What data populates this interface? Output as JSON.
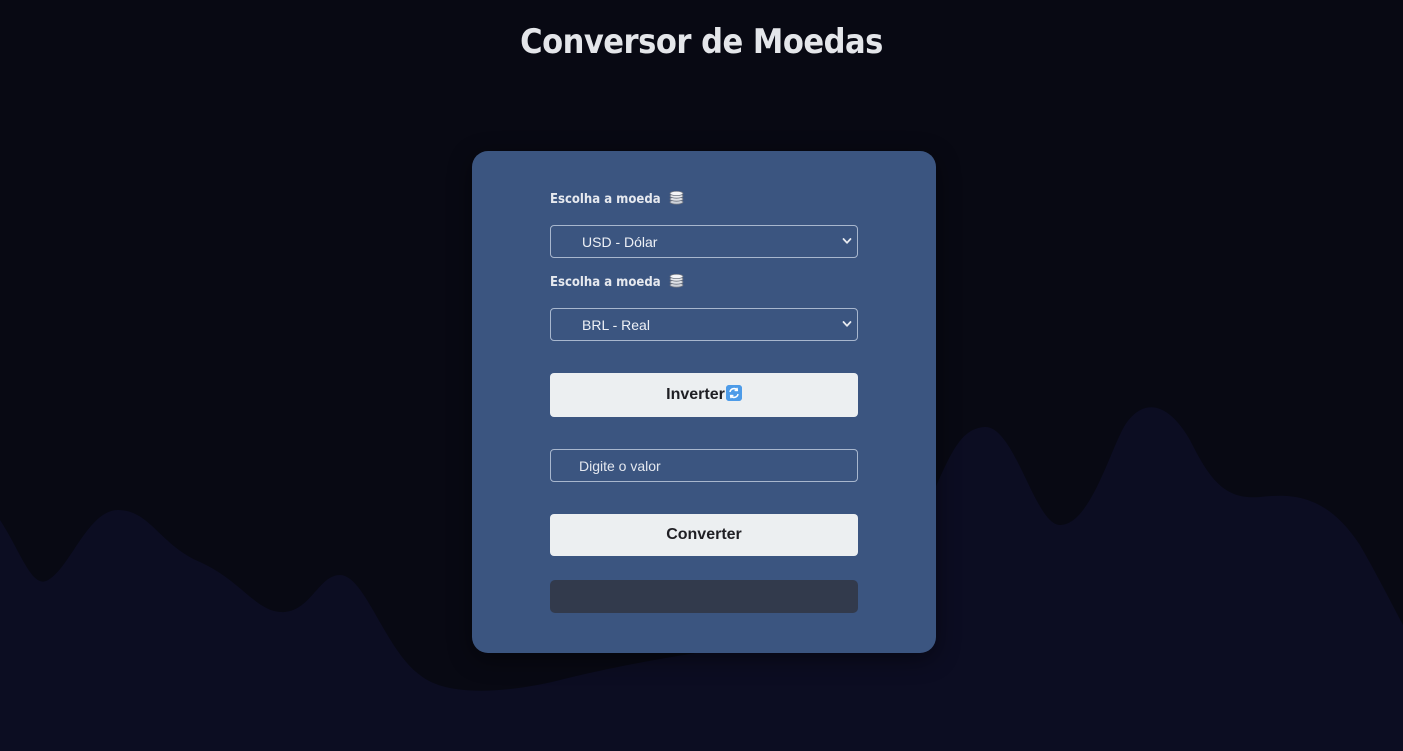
{
  "page": {
    "title": "Conversor de Moedas"
  },
  "form": {
    "from": {
      "label": "Escolha a moeda",
      "label_icon": "coins-icon",
      "selected": "USD - Dólar"
    },
    "to": {
      "label": "Escolha a moeda",
      "label_icon": "coins-icon",
      "selected": "BRL - Real"
    },
    "swap_button": {
      "label": "Inverter",
      "icon": "swap-icon"
    },
    "amount_input": {
      "placeholder": "Digite o valor",
      "value": ""
    },
    "convert_button": {
      "label": "Converter"
    },
    "result": ""
  },
  "colors": {
    "background": "#080913",
    "waves": "#0c0d22",
    "card": "#3b5580",
    "button": "#eceff1",
    "result_box": "#323a4c",
    "swap_icon": "#4d9be8"
  }
}
